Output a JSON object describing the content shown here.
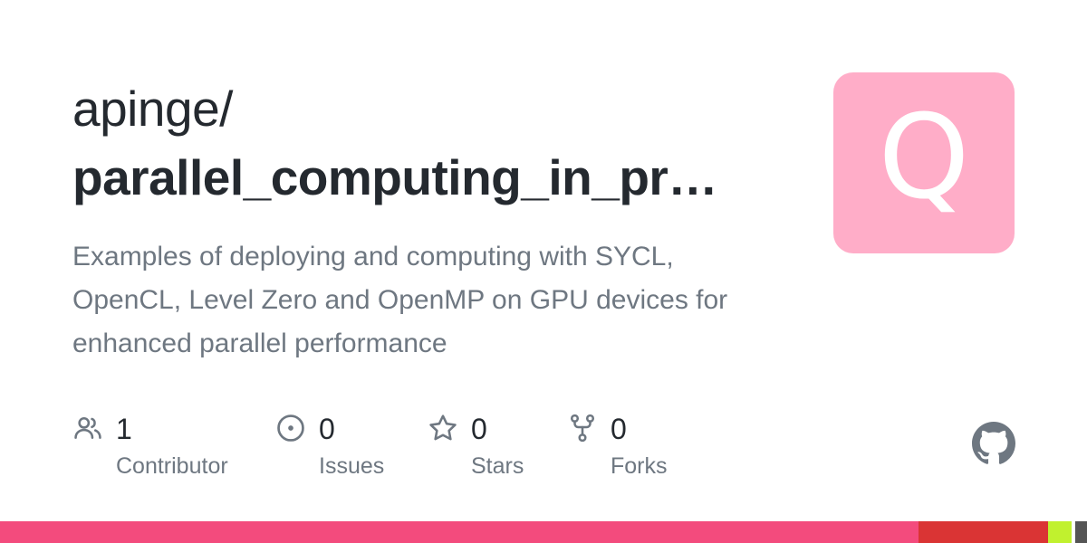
{
  "repo_card": {
    "owner": "apinge/",
    "repo_name": "parallel_computing_in_pr…",
    "description": "Examples of deploying and computing with SYCL, OpenCL, Level Zero and OpenMP on GPU devices for enhanced parallel performance",
    "avatar_letter": "Q",
    "avatar_color": "#ffadc8"
  },
  "stats": {
    "contributors": {
      "value": "1",
      "label": "Contributor",
      "icon": "people-icon"
    },
    "issues": {
      "value": "0",
      "label": "Issues",
      "icon": "issue-opened-icon"
    },
    "stars": {
      "value": "0",
      "label": "Stars",
      "icon": "star-icon"
    },
    "forks": {
      "value": "0",
      "label": "Forks",
      "icon": "repo-forked-icon"
    }
  },
  "language_bar": {
    "segments": [
      {
        "color": "#f34b7d",
        "fraction": 0.845
      },
      {
        "color": "#da3434",
        "fraction": 0.119
      },
      {
        "color": "#c1f12e",
        "fraction": 0.022
      },
      {
        "color": "#ffffff",
        "fraction": 0.003
      },
      {
        "color": "#555555",
        "fraction": 0.011
      }
    ]
  },
  "colors": {
    "text_primary": "#24292f",
    "text_secondary": "#6e7781",
    "icon": "#6e7781",
    "github_logo": "#6e7781"
  }
}
